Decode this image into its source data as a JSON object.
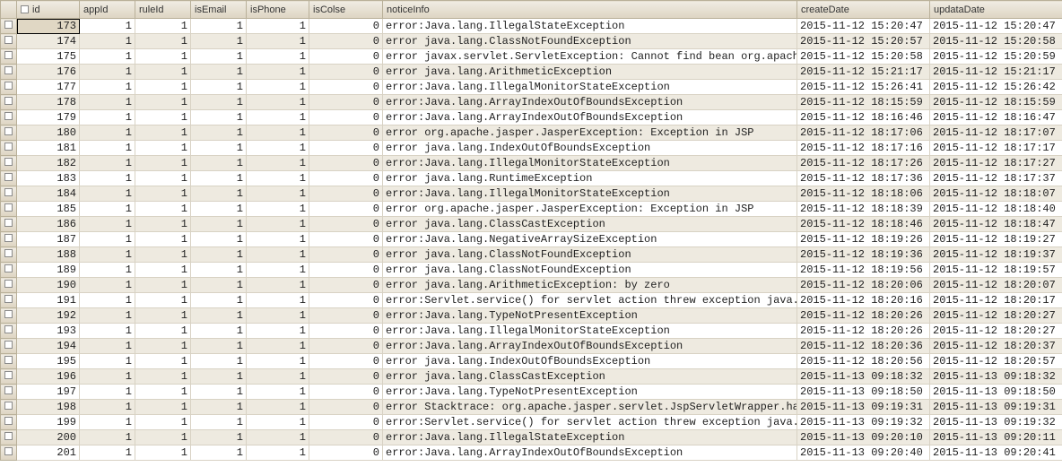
{
  "columns": {
    "id": "id",
    "appId": "appId",
    "ruleId": "ruleId",
    "isEmail": "isEmail",
    "isPhone": "isPhone",
    "isColse": "isColse",
    "noticeInfo": "noticeInfo",
    "createDate": "createDate",
    "updataDate": "updataDate"
  },
  "rows": [
    {
      "id": 173,
      "appId": 1,
      "ruleId": 1,
      "isEmail": 1,
      "isPhone": 1,
      "isColse": 0,
      "noticeInfo": "error:Java.lang.IllegalStateException",
      "createDate": "2015-11-12 15:20:47",
      "updataDate": "2015-11-12 15:20:47",
      "selected": true
    },
    {
      "id": 174,
      "appId": 1,
      "ruleId": 1,
      "isEmail": 1,
      "isPhone": 1,
      "isColse": 0,
      "noticeInfo": "error java.lang.ClassNotFoundException",
      "createDate": "2015-11-12 15:20:57",
      "updataDate": "2015-11-12 15:20:58"
    },
    {
      "id": 175,
      "appId": 1,
      "ruleId": 1,
      "isEmail": 1,
      "isPhone": 1,
      "isColse": 0,
      "noticeInfo": "error javax.servlet.ServletException: Cannot find bean org.apache.s",
      "createDate": "2015-11-12 15:20:58",
      "updataDate": "2015-11-12 15:20:59"
    },
    {
      "id": 176,
      "appId": 1,
      "ruleId": 1,
      "isEmail": 1,
      "isPhone": 1,
      "isColse": 0,
      "noticeInfo": "error java.lang.ArithmeticException",
      "createDate": "2015-11-12 15:21:17",
      "updataDate": "2015-11-12 15:21:17"
    },
    {
      "id": 177,
      "appId": 1,
      "ruleId": 1,
      "isEmail": 1,
      "isPhone": 1,
      "isColse": 0,
      "noticeInfo": "error:Java.lang.IllegalMonitorStateException",
      "createDate": "2015-11-12 15:26:41",
      "updataDate": "2015-11-12 15:26:42"
    },
    {
      "id": 178,
      "appId": 1,
      "ruleId": 1,
      "isEmail": 1,
      "isPhone": 1,
      "isColse": 0,
      "noticeInfo": "error:Java.lang.ArrayIndexOutOfBoundsException",
      "createDate": "2015-11-12 18:15:59",
      "updataDate": "2015-11-12 18:15:59"
    },
    {
      "id": 179,
      "appId": 1,
      "ruleId": 1,
      "isEmail": 1,
      "isPhone": 1,
      "isColse": 0,
      "noticeInfo": "error:Java.lang.ArrayIndexOutOfBoundsException",
      "createDate": "2015-11-12 18:16:46",
      "updataDate": "2015-11-12 18:16:47"
    },
    {
      "id": 180,
      "appId": 1,
      "ruleId": 1,
      "isEmail": 1,
      "isPhone": 1,
      "isColse": 0,
      "noticeInfo": "error org.apache.jasper.JasperException: Exception in JSP",
      "createDate": "2015-11-12 18:17:06",
      "updataDate": "2015-11-12 18:17:07"
    },
    {
      "id": 181,
      "appId": 1,
      "ruleId": 1,
      "isEmail": 1,
      "isPhone": 1,
      "isColse": 0,
      "noticeInfo": "error java.lang.IndexOutOfBoundsException",
      "createDate": "2015-11-12 18:17:16",
      "updataDate": "2015-11-12 18:17:17"
    },
    {
      "id": 182,
      "appId": 1,
      "ruleId": 1,
      "isEmail": 1,
      "isPhone": 1,
      "isColse": 0,
      "noticeInfo": "error:Java.lang.IllegalMonitorStateException",
      "createDate": "2015-11-12 18:17:26",
      "updataDate": "2015-11-12 18:17:27"
    },
    {
      "id": 183,
      "appId": 1,
      "ruleId": 1,
      "isEmail": 1,
      "isPhone": 1,
      "isColse": 0,
      "noticeInfo": "error java.lang.RuntimeException",
      "createDate": "2015-11-12 18:17:36",
      "updataDate": "2015-11-12 18:17:37"
    },
    {
      "id": 184,
      "appId": 1,
      "ruleId": 1,
      "isEmail": 1,
      "isPhone": 1,
      "isColse": 0,
      "noticeInfo": "error:Java.lang.IllegalMonitorStateException",
      "createDate": "2015-11-12 18:18:06",
      "updataDate": "2015-11-12 18:18:07"
    },
    {
      "id": 185,
      "appId": 1,
      "ruleId": 1,
      "isEmail": 1,
      "isPhone": 1,
      "isColse": 0,
      "noticeInfo": "error org.apache.jasper.JasperException: Exception in JSP",
      "createDate": "2015-11-12 18:18:39",
      "updataDate": "2015-11-12 18:18:40"
    },
    {
      "id": 186,
      "appId": 1,
      "ruleId": 1,
      "isEmail": 1,
      "isPhone": 1,
      "isColse": 0,
      "noticeInfo": "error java.lang.ClassCastException",
      "createDate": "2015-11-12 18:18:46",
      "updataDate": "2015-11-12 18:18:47"
    },
    {
      "id": 187,
      "appId": 1,
      "ruleId": 1,
      "isEmail": 1,
      "isPhone": 1,
      "isColse": 0,
      "noticeInfo": "error:Java.lang.NegativeArraySizeException",
      "createDate": "2015-11-12 18:19:26",
      "updataDate": "2015-11-12 18:19:27"
    },
    {
      "id": 188,
      "appId": 1,
      "ruleId": 1,
      "isEmail": 1,
      "isPhone": 1,
      "isColse": 0,
      "noticeInfo": "error java.lang.ClassNotFoundException",
      "createDate": "2015-11-12 18:19:36",
      "updataDate": "2015-11-12 18:19:37"
    },
    {
      "id": 189,
      "appId": 1,
      "ruleId": 1,
      "isEmail": 1,
      "isPhone": 1,
      "isColse": 0,
      "noticeInfo": "error java.lang.ClassNotFoundException",
      "createDate": "2015-11-12 18:19:56",
      "updataDate": "2015-11-12 18:19:57"
    },
    {
      "id": 190,
      "appId": 1,
      "ruleId": 1,
      "isEmail": 1,
      "isPhone": 1,
      "isColse": 0,
      "noticeInfo": "error java.lang.ArithmeticException:  by zero",
      "createDate": "2015-11-12 18:20:06",
      "updataDate": "2015-11-12 18:20:07"
    },
    {
      "id": 191,
      "appId": 1,
      "ruleId": 1,
      "isEmail": 1,
      "isPhone": 1,
      "isColse": 0,
      "noticeInfo": "error:Servlet.service() for servlet action threw exception java.lan",
      "createDate": "2015-11-12 18:20:16",
      "updataDate": "2015-11-12 18:20:17"
    },
    {
      "id": 192,
      "appId": 1,
      "ruleId": 1,
      "isEmail": 1,
      "isPhone": 1,
      "isColse": 0,
      "noticeInfo": "error:Java.lang.TypeNotPresentException",
      "createDate": "2015-11-12 18:20:26",
      "updataDate": "2015-11-12 18:20:27"
    },
    {
      "id": 193,
      "appId": 1,
      "ruleId": 1,
      "isEmail": 1,
      "isPhone": 1,
      "isColse": 0,
      "noticeInfo": "error:Java.lang.IllegalMonitorStateException",
      "createDate": "2015-11-12 18:20:26",
      "updataDate": "2015-11-12 18:20:27"
    },
    {
      "id": 194,
      "appId": 1,
      "ruleId": 1,
      "isEmail": 1,
      "isPhone": 1,
      "isColse": 0,
      "noticeInfo": "error:Java.lang.ArrayIndexOutOfBoundsException",
      "createDate": "2015-11-12 18:20:36",
      "updataDate": "2015-11-12 18:20:37"
    },
    {
      "id": 195,
      "appId": 1,
      "ruleId": 1,
      "isEmail": 1,
      "isPhone": 1,
      "isColse": 0,
      "noticeInfo": "error java.lang.IndexOutOfBoundsException",
      "createDate": "2015-11-12 18:20:56",
      "updataDate": "2015-11-12 18:20:57"
    },
    {
      "id": 196,
      "appId": 1,
      "ruleId": 1,
      "isEmail": 1,
      "isPhone": 1,
      "isColse": 0,
      "noticeInfo": "error java.lang.ClassCastException",
      "createDate": "2015-11-13 09:18:32",
      "updataDate": "2015-11-13 09:18:32"
    },
    {
      "id": 197,
      "appId": 1,
      "ruleId": 1,
      "isEmail": 1,
      "isPhone": 1,
      "isColse": 0,
      "noticeInfo": "error:Java.lang.TypeNotPresentException",
      "createDate": "2015-11-13 09:18:50",
      "updataDate": "2015-11-13 09:18:50"
    },
    {
      "id": 198,
      "appId": 1,
      "ruleId": 1,
      "isEmail": 1,
      "isPhone": 1,
      "isColse": 0,
      "noticeInfo": "error Stacktrace:  org.apache.jasper.servlet.JspServletWrapper.hand",
      "createDate": "2015-11-13 09:19:31",
      "updataDate": "2015-11-13 09:19:31"
    },
    {
      "id": 199,
      "appId": 1,
      "ruleId": 1,
      "isEmail": 1,
      "isPhone": 1,
      "isColse": 0,
      "noticeInfo": "error:Servlet.service() for servlet action threw exception java.lan",
      "createDate": "2015-11-13 09:19:32",
      "updataDate": "2015-11-13 09:19:32"
    },
    {
      "id": 200,
      "appId": 1,
      "ruleId": 1,
      "isEmail": 1,
      "isPhone": 1,
      "isColse": 0,
      "noticeInfo": "error:Java.lang.IllegalStateException",
      "createDate": "2015-11-13 09:20:10",
      "updataDate": "2015-11-13 09:20:11"
    },
    {
      "id": 201,
      "appId": 1,
      "ruleId": 1,
      "isEmail": 1,
      "isPhone": 1,
      "isColse": 0,
      "noticeInfo": "error:Java.lang.ArrayIndexOutOfBoundsException",
      "createDate": "2015-11-13 09:20:40",
      "updataDate": "2015-11-13 09:20:41"
    }
  ]
}
